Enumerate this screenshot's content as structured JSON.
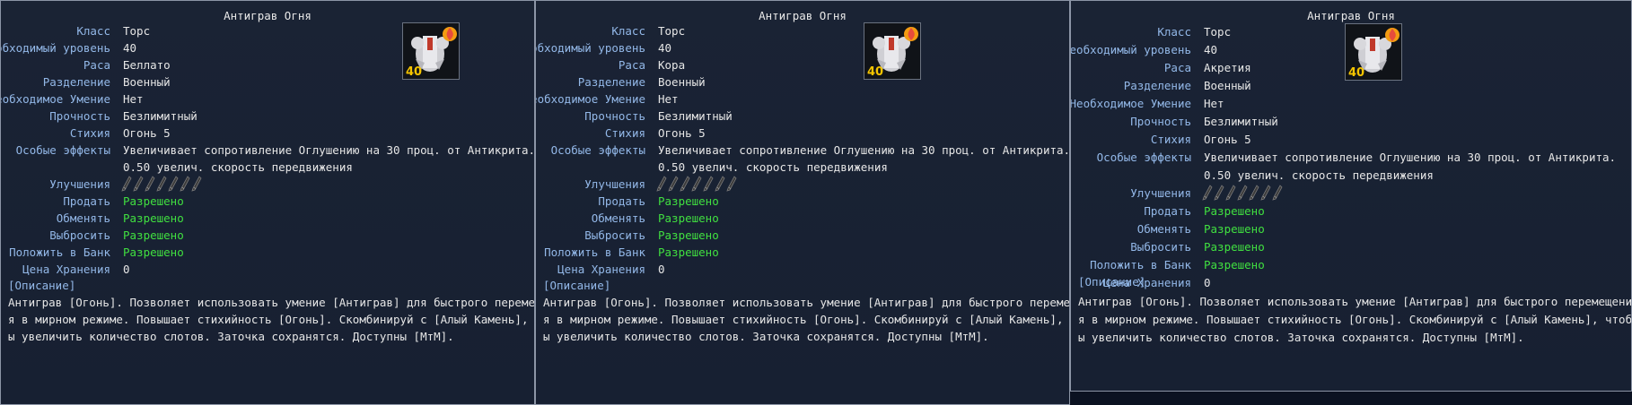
{
  "panels": [
    {
      "title": "Антиграв Огня",
      "level_badge": "40",
      "fields": {
        "class_label": "Класс",
        "class_value": "Торс",
        "level_label": "Необходимый уровень",
        "level_value": "40",
        "race_label": "Раса",
        "race_value": "Беллато",
        "division_label": "Разделение",
        "division_value": "Военный",
        "skill_label": "Необходимое Умение",
        "skill_value": "Нет",
        "durability_label": "Прочность",
        "durability_value": "Безлимитный",
        "element_label": "Стихия",
        "element_value": "Огонь 5",
        "effects_label": "Особые эффекты",
        "effects_line1": "Увеличивает сопротивление Оглушению на 30 проц. от Антикрита.",
        "effects_line2": "0.50 увелич. скорость передвижения",
        "upgrades_label": "Улучшения",
        "sell_label": "Продать",
        "sell_value": "Разрешено",
        "trade_label": "Обменять",
        "trade_value": "Разрешено",
        "drop_label": "Выбросить",
        "drop_value": "Разрешено",
        "bank_label": "Положить в Банк",
        "bank_value": "Разрешено",
        "storage_label": "Цена Хранения",
        "storage_value": "0"
      },
      "description_header": "[Описание]",
      "description_lines": [
        "Антиграв [Огонь]. Позволяет использовать умение [Антиграв] для быстрого перемещени",
        "я в мирном режиме. Повышает стихийность [Огонь]. Скомбинируй с [Алый Камень], чтоб",
        "ы увеличить количество слотов. Заточка сохранятся. Доступны [МтМ]."
      ]
    },
    {
      "title": "Антиграв Огня",
      "level_badge": "40",
      "fields": {
        "class_label": "Класс",
        "class_value": "Торс",
        "level_label": "Необходимый уровень",
        "level_value": "40",
        "race_label": "Раса",
        "race_value": "Кора",
        "division_label": "Разделение",
        "division_value": "Военный",
        "skill_label": "Необходимое Умение",
        "skill_value": "Нет",
        "durability_label": "Прочность",
        "durability_value": "Безлимитный",
        "element_label": "Стихия",
        "element_value": "Огонь 5",
        "effects_label": "Особые эффекты",
        "effects_line1": "Увеличивает сопротивление Оглушению на 30 проц. от Антикрита.",
        "effects_line2": "0.50 увелич. скорость передвижения",
        "upgrades_label": "Улучшения",
        "sell_label": "Продать",
        "sell_value": "Разрешено",
        "trade_label": "Обменять",
        "trade_value": "Разрешено",
        "drop_label": "Выбросить",
        "drop_value": "Разрешено",
        "bank_label": "Положить в Банк",
        "bank_value": "Разрешено",
        "storage_label": "Цена Хранения",
        "storage_value": "0"
      },
      "description_header": "[Описание]",
      "description_lines": [
        "Антиграв [Огонь]. Позволяет использовать умение [Антиграв] для быстрого перемещени",
        "я в мирном режиме. Повышает стихийность [Огонь]. Скомбинируй с [Алый Камень], чтоб",
        "ы увеличить количество слотов. Заточка сохранятся. Доступны [МтМ]."
      ]
    },
    {
      "title": "Антиграв Огня",
      "level_badge": "40",
      "fields": {
        "class_label": "Класс",
        "class_value": "Торс",
        "level_label": "Необходимый уровень",
        "level_value": "40",
        "race_label": "Раса",
        "race_value": "Акретия",
        "division_label": "Разделение",
        "division_value": "Военный",
        "skill_label": "Необходимое Умение",
        "skill_value": "Нет",
        "durability_label": "Прочность",
        "durability_value": "Безлимитный",
        "element_label": "Стихия",
        "element_value": "Огонь 5",
        "effects_label": "Особые эффекты",
        "effects_line1": "Увеличивает сопротивление Оглушению на 30 проц. от Антикрита.",
        "effects_line2": "0.50 увелич. скорость передвижения",
        "upgrades_label": "Улучшения",
        "sell_label": "Продать",
        "sell_value": "Разрешено",
        "trade_label": "Обменять",
        "trade_value": "Разрешено",
        "drop_label": "Выбросить",
        "drop_value": "Разрешено",
        "bank_label": "Положить в Банк",
        "bank_value": "Разрешено",
        "storage_label": "Цена Хранения",
        "storage_value": "0"
      },
      "description_header": "[Описание]",
      "description_lines": [
        "Антиграв [Огонь]. Позволяет использовать умение [Антиграв] для быстрого перемещени",
        "я в мирном режиме. Повышает стихийность [Огонь]. Скомбинируй с [Алый Камень], чтоб",
        "ы увеличить количество слотов. Заточка сохранятся. Доступны [МтМ]."
      ]
    }
  ],
  "colors": {
    "label": "#93b8e8",
    "value": "#e6e6e6",
    "allowed": "#40e040",
    "panel_bg": "#19223a",
    "border": "#8c95a6"
  },
  "icons": {
    "item_icon": "torso-armor-icon",
    "fire_badge": "fire-element-icon",
    "upgrade_slot": "empty-upgrade-slot-icon"
  },
  "upgrade_slots": 7
}
